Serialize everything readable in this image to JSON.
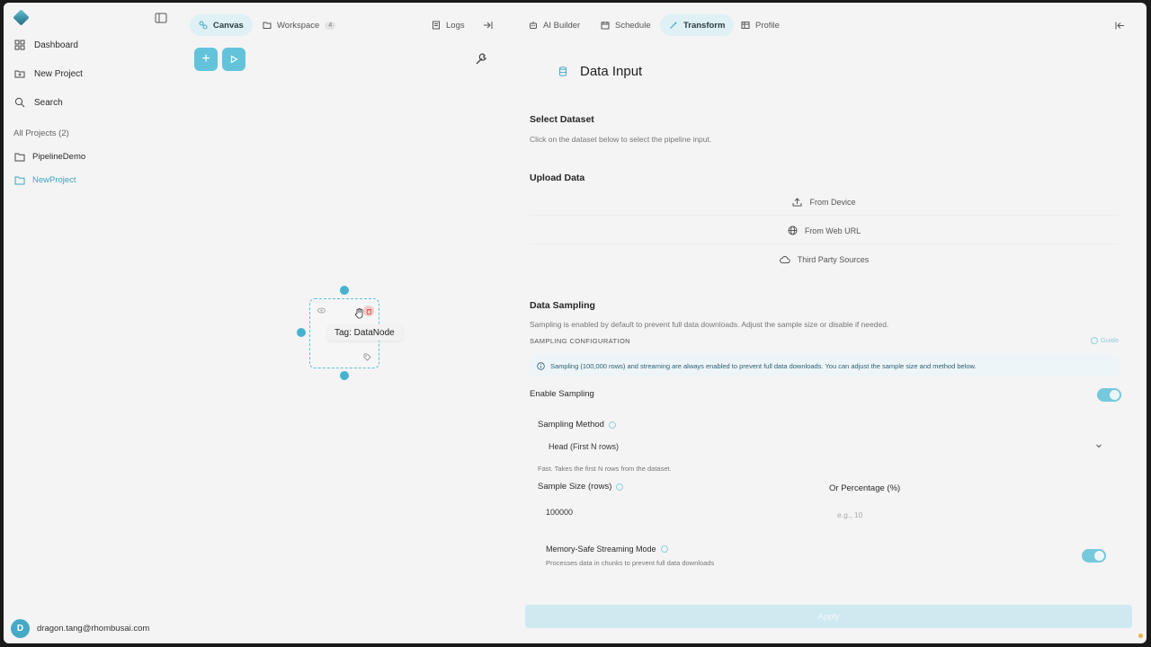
{
  "sidebar": {
    "nav": [
      {
        "label": "Dashboard",
        "icon": "dashboard-icon"
      },
      {
        "label": "New Project",
        "icon": "new-project-icon"
      },
      {
        "label": "Search",
        "icon": "search-icon"
      }
    ],
    "projects_label": "All Projects (2)",
    "projects": [
      {
        "label": "PipelineDemo",
        "active": false
      },
      {
        "label": "NewProject",
        "active": true
      }
    ],
    "user": {
      "initial": "D",
      "email": "dragon.tang@rhombusai.com"
    }
  },
  "topbar": {
    "tabs": [
      {
        "label": "Canvas",
        "active": true,
        "icon": "canvas-icon"
      },
      {
        "label": "Workspace",
        "badge": "4",
        "icon": "folder-icon"
      },
      {
        "label": "Logs",
        "icon": "logs-icon"
      },
      {
        "label": "AI Builder",
        "icon": "robot-icon"
      },
      {
        "label": "Schedule",
        "icon": "calendar-icon"
      },
      {
        "label": "Transform",
        "active": true,
        "icon": "wand-icon"
      },
      {
        "label": "Profile",
        "icon": "table-icon"
      }
    ]
  },
  "canvas": {
    "add_button": "+",
    "node_tooltip": "Tag: DataNode"
  },
  "panel": {
    "title": "Data Input",
    "select_dataset": {
      "heading": "Select Dataset",
      "description": "Click on the dataset below to select the pipeline input."
    },
    "upload": {
      "heading": "Upload Data",
      "options": [
        "From Device",
        "From Web URL",
        "Third Party Sources"
      ]
    },
    "sampling": {
      "heading": "Data Sampling",
      "description": "Sampling is enabled by default to prevent full data downloads. Adjust the sample size or disable if needed.",
      "config_label": "SAMPLING CONFIGURATION",
      "guide": "Guide",
      "info": "Sampling (100,000 rows) and streaming are always enabled to prevent full data downloads. You can adjust the sample size and method below.",
      "enable_label": "Enable Sampling",
      "enabled": true,
      "method_label": "Sampling Method",
      "method_value": "Head (First N rows)",
      "method_hint": "Fast. Takes the first N rows from the dataset.",
      "size_label": "Sample Size (rows)",
      "size_value": "100000",
      "percentage_label": "Or Percentage (%)",
      "percentage_placeholder": "e.g., 10",
      "streaming_label": "Memory-Safe Streaming Mode",
      "streaming_desc": "Processes data in chunks to prevent full data downloads",
      "streaming_enabled": true
    },
    "apply_label": "Apply"
  },
  "colors": {
    "accent": "#46a9c6",
    "accent_light": "#dff1f5",
    "background": "#f4f4f4"
  }
}
